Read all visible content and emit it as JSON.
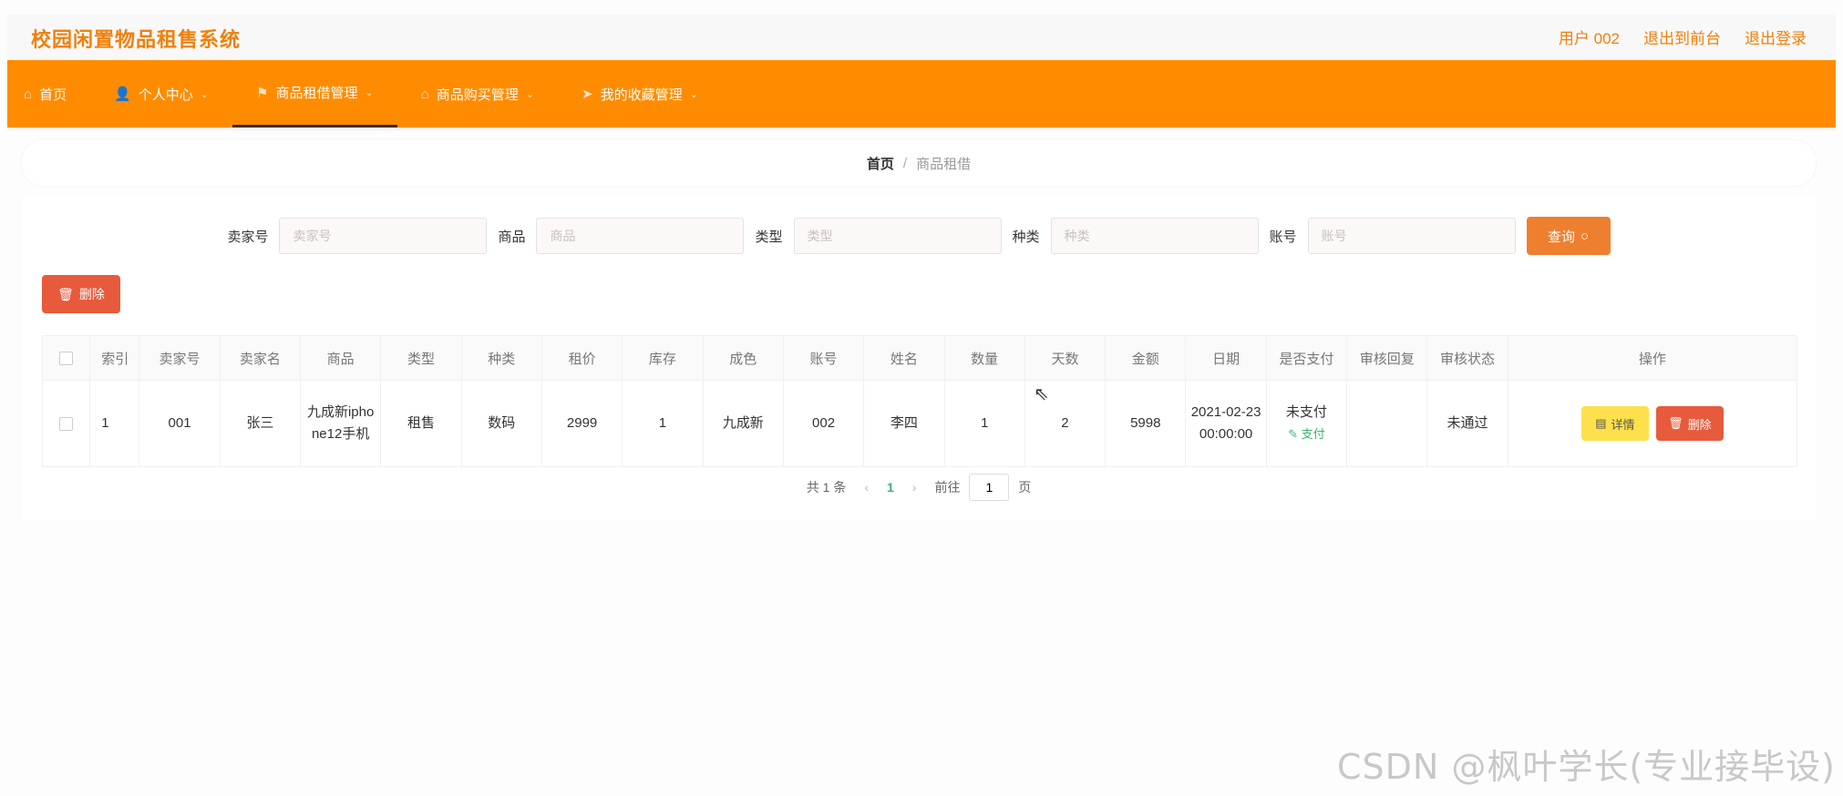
{
  "header": {
    "app_title": "校园闲置物品租售系统",
    "user_label": "用户 002",
    "front_label": "退出到前台",
    "logout_label": "退出登录"
  },
  "nav": [
    {
      "label": "首页",
      "icon": "home-icon",
      "glyph": "⌂",
      "has_dropdown": false,
      "active": false
    },
    {
      "label": "个人中心",
      "icon": "user-icon",
      "glyph": "👤",
      "has_dropdown": true,
      "active": false
    },
    {
      "label": "商品租借管理",
      "icon": "flag-icon",
      "glyph": "⚑",
      "has_dropdown": true,
      "active": true
    },
    {
      "label": "商品购买管理",
      "icon": "shop-icon",
      "glyph": "⌂",
      "has_dropdown": true,
      "active": false
    },
    {
      "label": "我的收藏管理",
      "icon": "send-icon",
      "glyph": "➤",
      "has_dropdown": true,
      "active": false
    }
  ],
  "breadcrumb": {
    "home": "首页",
    "separator": "/",
    "current": "商品租借"
  },
  "search": {
    "fields": [
      {
        "label": "卖家号",
        "placeholder": "卖家号"
      },
      {
        "label": "商品",
        "placeholder": "商品"
      },
      {
        "label": "类型",
        "placeholder": "类型"
      },
      {
        "label": "种类",
        "placeholder": "种类"
      },
      {
        "label": "账号",
        "placeholder": "账号"
      }
    ],
    "query_label": "查询"
  },
  "toolbar": {
    "delete_label": "删除"
  },
  "table": {
    "headers": [
      "索引",
      "卖家号",
      "卖家名",
      "商品",
      "类型",
      "种类",
      "租价",
      "库存",
      "成色",
      "账号",
      "姓名",
      "数量",
      "天数",
      "金额",
      "日期",
      "是否支付",
      "审核回复",
      "审核状态",
      "操作"
    ],
    "rows": [
      {
        "cells": [
          "1",
          "001",
          "张三",
          "九成新iphone12手机",
          "租售",
          "数码",
          "2999",
          "1",
          "九成新",
          "002",
          "李四",
          "1",
          "2",
          "5998",
          "2021-02-23 00:00:00",
          "未支付",
          "",
          "未通过"
        ],
        "pay_link": "支付",
        "detail_label": "详情",
        "delete_label": "删除"
      }
    ]
  },
  "pagination": {
    "total": "共 1 条",
    "prev": "‹",
    "current": "1",
    "next": "›",
    "goto": "前往",
    "page_value": "1",
    "page_suffix": "页"
  },
  "watermark": "CSDN @枫叶学长(专业接毕设)",
  "colors": {
    "accent": "#ff8c00",
    "title": "#f0800a",
    "danger": "#e85a3c",
    "warning": "#fde04b",
    "success": "#3bb273"
  }
}
